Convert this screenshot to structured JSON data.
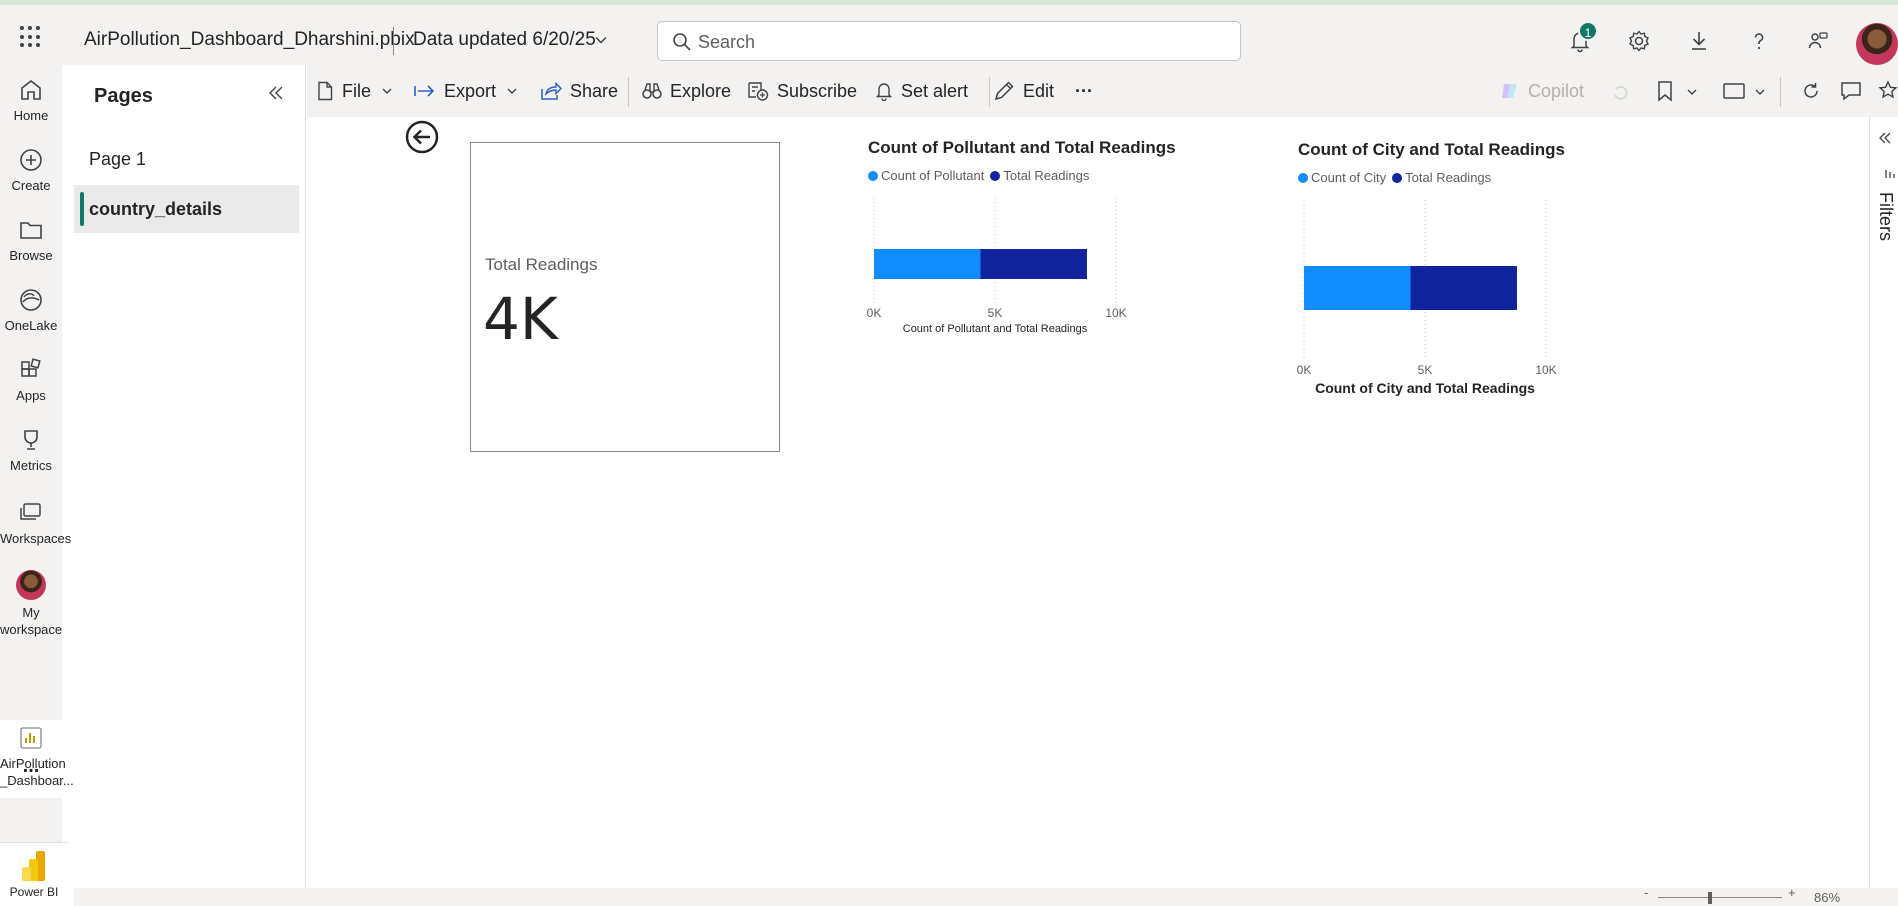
{
  "header": {
    "file_title": "AirPollution_Dashboard_Dharshini.pbix",
    "data_updated": "Data updated 6/20/25",
    "search_placeholder": "Search",
    "notification_count": "1"
  },
  "rail": {
    "items": [
      {
        "label": "Home",
        "icon": "home-icon"
      },
      {
        "label": "Create",
        "icon": "create-icon"
      },
      {
        "label": "Browse",
        "icon": "browse-icon"
      },
      {
        "label": "OneLake",
        "icon": "onelake-icon"
      },
      {
        "label": "Apps",
        "icon": "apps-icon"
      },
      {
        "label": "Metrics",
        "icon": "metrics-icon"
      },
      {
        "label": "Workspaces",
        "icon": "workspaces-icon"
      }
    ],
    "my_workspace_line1": "My",
    "my_workspace_line2": "workspace",
    "report_line1": "AirPollution",
    "report_line2": "_Dashboar...",
    "more": "...",
    "brand": "Power BI"
  },
  "pages": {
    "title": "Pages",
    "items": [
      {
        "label": "Page 1",
        "active": false
      },
      {
        "label": "country_details",
        "active": true
      }
    ]
  },
  "toolbar": {
    "file": "File",
    "export": "Export",
    "share": "Share",
    "explore": "Explore",
    "subscribe": "Subscribe",
    "set_alert": "Set alert",
    "edit": "Edit",
    "more": "···",
    "copilot": "Copilot"
  },
  "card": {
    "label": "Total Readings",
    "value": "4K"
  },
  "chart_data": [
    {
      "type": "bar",
      "orientation": "horizontal",
      "stacked": true,
      "title": "Count of Pollutant and Total Readings",
      "xlabel": "Count of Pollutant and Total Readings",
      "legend_position": "top-left",
      "series": [
        {
          "name": "Count of Pollutant",
          "values": [
            4400
          ],
          "color": "#118dff"
        },
        {
          "name": "Total Readings",
          "values": [
            4400
          ],
          "color": "#12239e"
        }
      ],
      "xlim": [
        0,
        10000
      ],
      "ticks": [
        "0K",
        "5K",
        "10K"
      ],
      "tick_values": [
        0,
        5000,
        10000
      ],
      "grid": true
    },
    {
      "type": "bar",
      "orientation": "horizontal",
      "stacked": true,
      "title": "Count of City and Total Readings",
      "xlabel": "Count of City and Total Readings",
      "legend_position": "top-left",
      "series": [
        {
          "name": "Count of City",
          "values": [
            4400
          ],
          "color": "#118dff"
        },
        {
          "name": "Total Readings",
          "values": [
            4400
          ],
          "color": "#12239e"
        }
      ],
      "xlim": [
        0,
        10000
      ],
      "ticks": [
        "0K",
        "5K",
        "10K"
      ],
      "tick_values": [
        0,
        5000,
        10000
      ],
      "grid": true
    }
  ],
  "filters": {
    "label": "Filters"
  },
  "status": {
    "zoom": "86%"
  }
}
